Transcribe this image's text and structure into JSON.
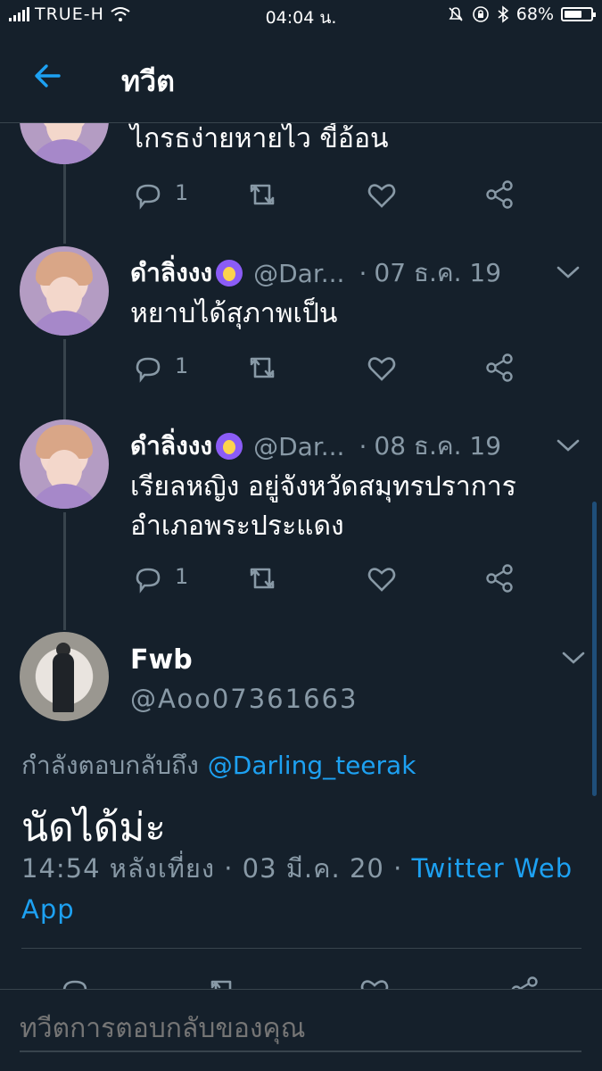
{
  "status_bar": {
    "carrier": "TRUE-H",
    "time": "04:04 น.",
    "battery": "68%",
    "battery_level": 0.68
  },
  "header": {
    "title": "ทวีต",
    "back_icon": "back-arrow-icon"
  },
  "tweets": [
    {
      "text": "ไกรธง่ายหายไว ขี้อ้อน",
      "reply_count": "1"
    },
    {
      "name": "ดำลิ่งงง",
      "handle": "@Dar...",
      "separator": "·",
      "date": "07 ธ.ค. 19",
      "text": "หยาบได้สุภาพเป็น",
      "reply_count": "1"
    },
    {
      "name": "ดำลิ่งงง",
      "handle": "@Dar...",
      "separator": "·",
      "date": "08 ธ.ค. 19",
      "text_line1": "เรียลหญิง อยู่จังหวัดสมุทรปราการ",
      "text_line2": "อำเภอพระประแดง",
      "reply_count": "1"
    }
  ],
  "main_tweet": {
    "name": "Fwb",
    "handle": "@Aoo07361663",
    "replying_label": "กำลังตอบกลับถึง",
    "replying_to": "@Darling_teerak",
    "text": "นัดได้ม่ะ",
    "meta_line": "14:54 หลังเที่ยง · 03 มี.ค. 20 · ",
    "source": "Twitter Web App"
  },
  "reply_bar": {
    "placeholder": "ทวีตการตอบกลับของคุณ"
  },
  "colors": {
    "background": "#15202b",
    "accent": "#1da1f2",
    "muted": "#8899a6",
    "border": "#38444d"
  }
}
